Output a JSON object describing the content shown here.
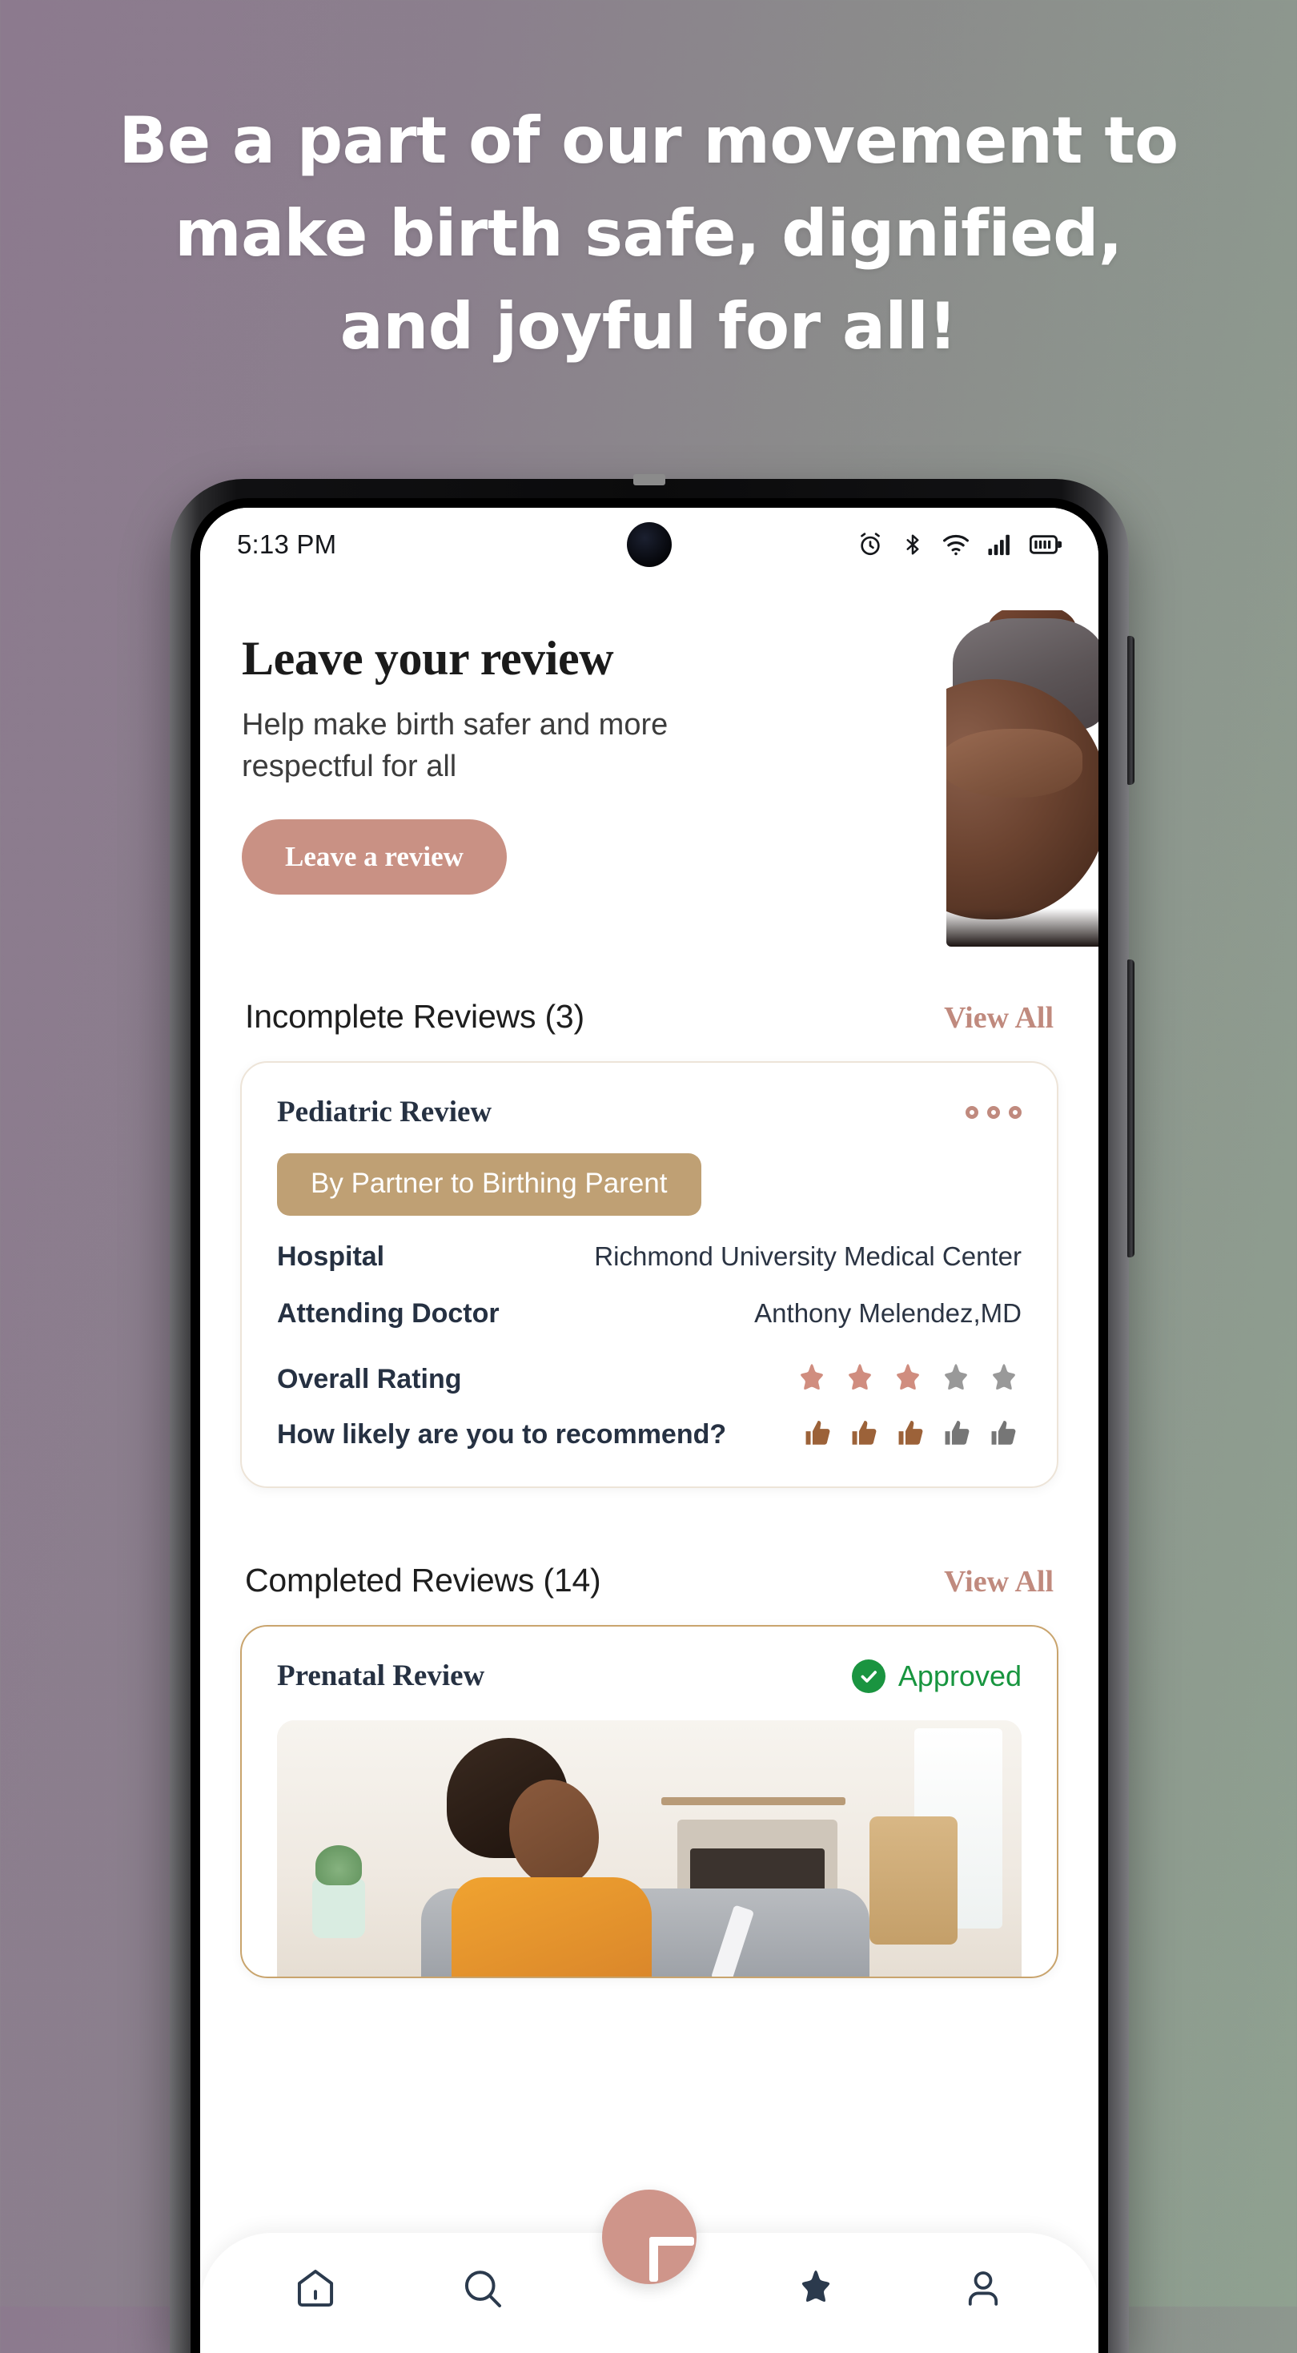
{
  "headline": "Be a part of our movement to make birth safe, dignified, and joyful for all!",
  "colors": {
    "accent_rose": "#c99184",
    "accent_tan": "#bfa074",
    "navy": "#263142",
    "approved_green": "#18953f",
    "star_filled": "#d08d7f",
    "star_empty": "#999999"
  },
  "status_bar": {
    "time": "5:13 PM",
    "icons": [
      "alarm-icon",
      "bluetooth-icon",
      "wifi-icon",
      "cellular-signal-icon",
      "battery-icon"
    ]
  },
  "hero": {
    "title": "Leave your review",
    "subtitle": "Help make birth safer and more respectful for all",
    "button_label": "Leave a review",
    "photo_alt": "pregnant-belly-photo"
  },
  "sections": [
    {
      "title": "Incomplete Reviews (3)",
      "view_all_label": "View All"
    },
    {
      "title": "Completed Reviews (14)",
      "view_all_label": "View All"
    }
  ],
  "incomplete_card": {
    "title": "Pediatric Review",
    "menu_icon": "three-dots-icon",
    "tag": "By Partner to Birthing Parent",
    "fields": [
      {
        "label": "Hospital",
        "value": "Richmond University Medical Center"
      },
      {
        "label": "Attending Doctor",
        "value": "Anthony Melendez,MD"
      }
    ],
    "overall_rating_label": "Overall Rating",
    "overall_rating_value": 3,
    "overall_rating_max": 5,
    "recommend_label": "How likely are you to recommend?",
    "recommend_value": 3,
    "recommend_max": 5
  },
  "completed_card": {
    "title": "Prenatal Review",
    "status_label": "Approved",
    "status_icon": "check-circle-icon",
    "photo_alt": "smiling-woman-with-phone-photo"
  },
  "bottom_nav": {
    "items": [
      {
        "name": "home-icon",
        "active": false
      },
      {
        "name": "search-icon",
        "active": false
      },
      {
        "name": "star-icon",
        "active": true
      },
      {
        "name": "profile-icon",
        "active": false
      }
    ],
    "fab_icon": "plus-icon"
  }
}
